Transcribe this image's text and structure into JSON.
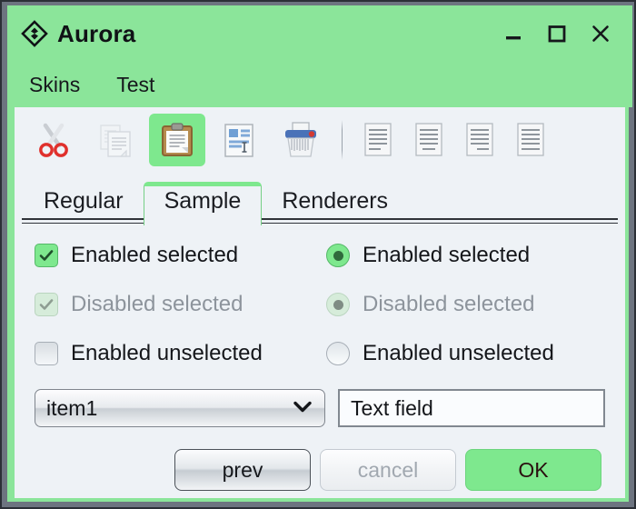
{
  "window": {
    "title": "Aurora",
    "logo_icon": "diamond-logo-icon",
    "controls": [
      {
        "name": "minimize",
        "icon": "minimize-icon"
      },
      {
        "name": "maximize",
        "icon": "maximize-icon"
      },
      {
        "name": "close",
        "icon": "close-icon"
      }
    ]
  },
  "menubar": {
    "items": [
      {
        "label": "Skins"
      },
      {
        "label": "Test"
      }
    ]
  },
  "toolbar": {
    "buttons": [
      {
        "name": "cut",
        "icon": "scissors-icon",
        "state": "enabled"
      },
      {
        "name": "copy",
        "icon": "copy-documents-icon",
        "state": "disabled"
      },
      {
        "name": "paste",
        "icon": "clipboard-paste-icon",
        "state": "selected"
      },
      {
        "name": "edit-document",
        "icon": "document-edit-icon",
        "state": "enabled"
      },
      {
        "name": "shred",
        "icon": "paper-shredder-icon",
        "state": "enabled"
      }
    ],
    "align_buttons": [
      {
        "name": "align-left",
        "icon": "align-left-icon"
      },
      {
        "name": "align-center",
        "icon": "align-center-icon"
      },
      {
        "name": "align-right",
        "icon": "align-right-icon"
      },
      {
        "name": "align-justify",
        "icon": "align-justify-icon"
      }
    ]
  },
  "tabs": {
    "items": [
      {
        "label": "Regular",
        "active": false
      },
      {
        "label": "Sample",
        "active": true
      },
      {
        "label": "Renderers",
        "active": false
      }
    ]
  },
  "panel": {
    "checkboxes": [
      {
        "label": "Enabled selected",
        "state": "checked-enabled"
      },
      {
        "label": "Disabled selected",
        "state": "checked-disabled"
      },
      {
        "label": "Enabled unselected",
        "state": "unchecked-enabled"
      }
    ],
    "radios": [
      {
        "label": "Enabled selected",
        "state": "selected-enabled"
      },
      {
        "label": "Disabled selected",
        "state": "selected-disabled"
      },
      {
        "label": "Enabled unselected",
        "state": "unselected-enabled"
      }
    ],
    "combo": {
      "value": "item1",
      "icon": "chevron-down-icon"
    },
    "textfield": {
      "value": "Text field",
      "placeholder": "Text field"
    },
    "buttons": [
      {
        "label": "prev",
        "style": "normal"
      },
      {
        "label": "cancel",
        "style": "disabled"
      },
      {
        "label": "OK",
        "style": "primary"
      }
    ]
  },
  "colors": {
    "accent_green": "#7ee88e",
    "title_green": "#8be59a",
    "panel_bg": "#eef2f6",
    "frame_dark": "#6d7480",
    "text": "#14161a",
    "text_disabled": "#8d949c"
  }
}
